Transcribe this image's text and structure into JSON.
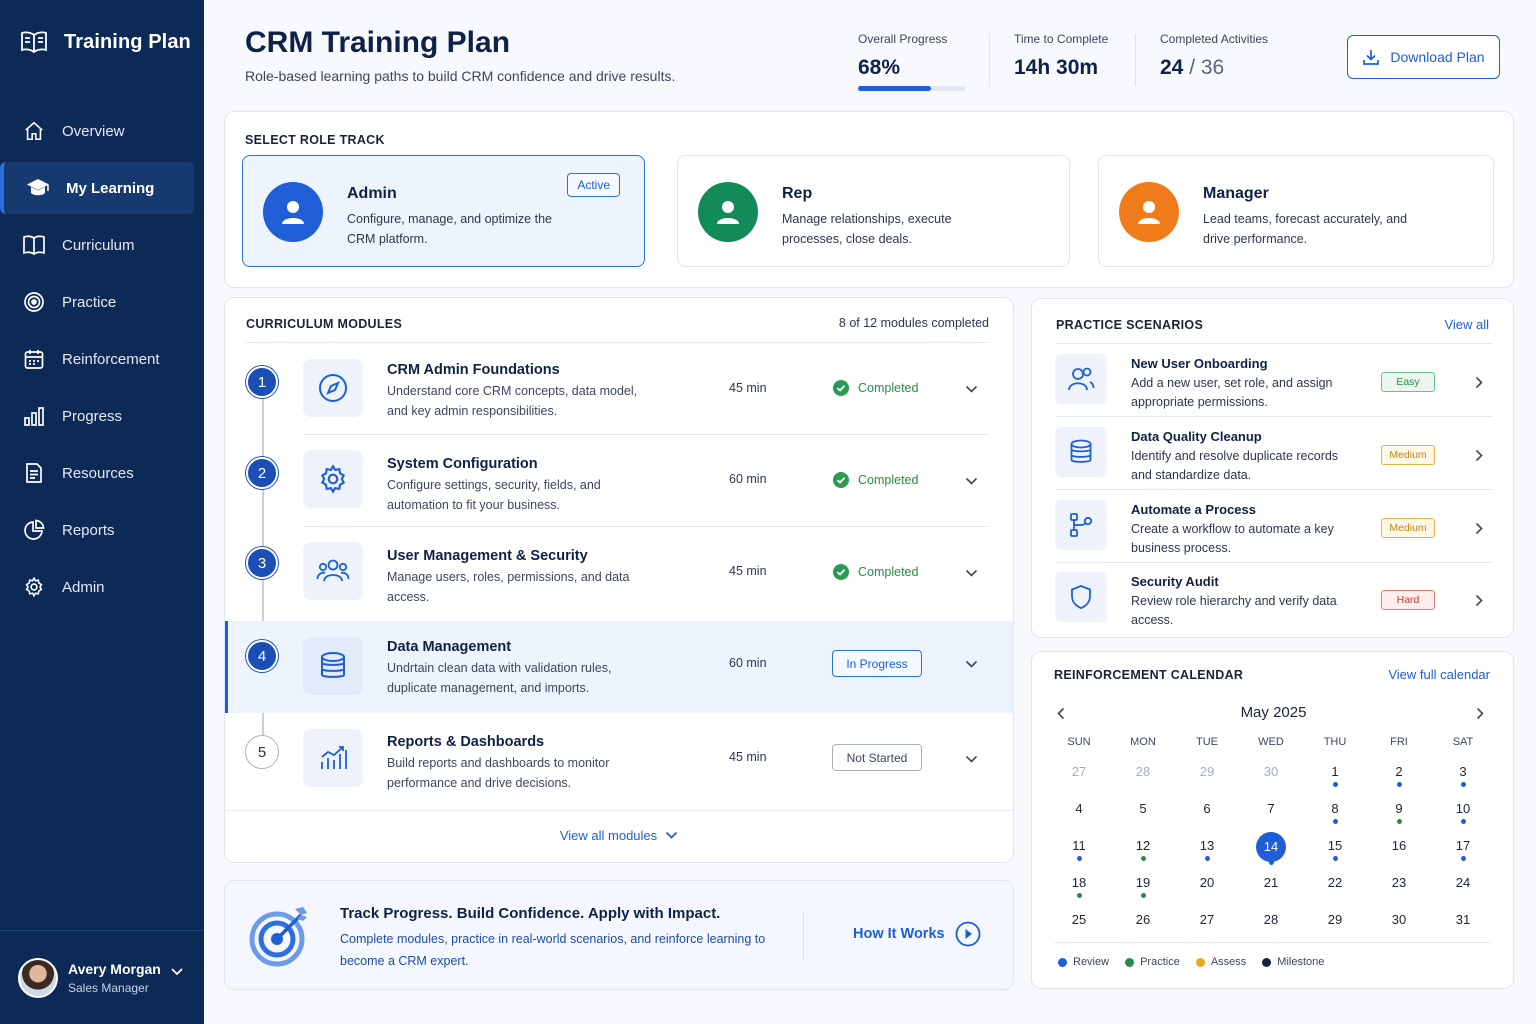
{
  "colors": {
    "sidebar": "#0d2a57",
    "primary": "#1f5ed6",
    "success": "#2b8a4a",
    "warning": "#e6b34a",
    "danger": "#c8372f",
    "admin": "#1f5ed6",
    "rep": "#138a5a",
    "manager": "#f07b1a"
  },
  "sidebar": {
    "brand": "Training Plan",
    "items": [
      {
        "label": "Overview",
        "icon": "home-icon"
      },
      {
        "label": "My Learning",
        "icon": "graduation-cap-icon",
        "active": true
      },
      {
        "label": "Curriculum",
        "icon": "book-icon"
      },
      {
        "label": "Practice",
        "icon": "target-icon"
      },
      {
        "label": "Reinforcement",
        "icon": "calendar-icon"
      },
      {
        "label": "Progress",
        "icon": "bar-chart-icon"
      },
      {
        "label": "Resources",
        "icon": "document-icon"
      },
      {
        "label": "Reports",
        "icon": "pie-chart-icon"
      },
      {
        "label": "Admin",
        "icon": "gear-icon"
      }
    ],
    "user": {
      "name": "Avery Morgan",
      "role": "Sales Manager"
    }
  },
  "header": {
    "title": "CRM Training Plan",
    "subtitle": "Role-based learning paths to build CRM confidence and drive results.",
    "stats": {
      "progress_label": "Overall Progress",
      "progress_value": "68%",
      "progress_fraction": 0.68,
      "time_label": "Time to Complete",
      "time_value": "14h 30m",
      "activities_label": "Completed Activities",
      "activities_done": "24",
      "activities_total": "/ 36"
    },
    "download_label": "Download Plan"
  },
  "roles": {
    "title": "SELECT ROLE TRACK",
    "active_badge": "Active",
    "items": [
      {
        "name": "Admin",
        "desc": "Configure, manage, and optimize the CRM platform."
      },
      {
        "name": "Rep",
        "desc": "Manage relationships, execute processes, close deals."
      },
      {
        "name": "Manager",
        "desc": "Lead teams, forecast accurately, and drive performance."
      }
    ]
  },
  "modules": {
    "title": "CURRICULUM MODULES",
    "count": "8 of 12 modules completed",
    "items": [
      {
        "num": "1",
        "icon": "compass-icon",
        "title": "CRM Admin Foundations",
        "desc": "Understand core CRM concepts, data model, and key admin responsibilities.",
        "time": "45 min",
        "status": "Completed"
      },
      {
        "num": "2",
        "icon": "gear-icon",
        "title": "System Configuration",
        "desc": "Configure settings, security, fields, and automation to fit your business.",
        "time": "60 min",
        "status": "Completed"
      },
      {
        "num": "3",
        "icon": "users-icon",
        "title": "User Management & Security",
        "desc": "Manage users, roles, permissions, and data access.",
        "time": "45 min",
        "status": "Completed"
      },
      {
        "num": "4",
        "icon": "database-icon",
        "title": "Data Management",
        "desc": "Undrtain clean data with validation rules, duplicate management, and imports.",
        "time": "60 min",
        "status": "In Progress"
      },
      {
        "num": "5",
        "icon": "analytics-icon",
        "title": "Reports & Dashboards",
        "desc": "Build reports and dashboards to monitor performance and drive decisions.",
        "time": "45 min",
        "status": "Not Started"
      }
    ],
    "view_all": "View all modules"
  },
  "track": {
    "title": "Track Progress. Build Confidence. Apply with Impact.",
    "desc": "Complete modules, practice in real-world scenarios, and reinforce learning to become a CRM expert.",
    "link": "How It Works"
  },
  "practice": {
    "title": "PRACTICE SCENARIOS",
    "view_all": "View all",
    "items": [
      {
        "icon": "users-icon",
        "title": "New User Onboarding",
        "desc": "Add a new user, set role, and assign appropriate permissions.",
        "difficulty": "Easy"
      },
      {
        "icon": "database-icon",
        "title": "Data Quality Cleanup",
        "desc": "Identify and resolve duplicate records and standardize data.",
        "difficulty": "Medium"
      },
      {
        "icon": "workflow-icon",
        "title": "Automate a Process",
        "desc": "Create a workflow to automate a key business process.",
        "difficulty": "Medium"
      },
      {
        "icon": "shield-icon",
        "title": "Security Audit",
        "desc": "Review role hierarchy and verify data access.",
        "difficulty": "Hard"
      }
    ]
  },
  "calendar": {
    "title": "REINFORCEMENT CALENDAR",
    "view_all": "View full calendar",
    "month": "May 2025",
    "weekdays": [
      "SUN",
      "MON",
      "TUE",
      "WED",
      "THU",
      "FRI",
      "SAT"
    ],
    "weeks": [
      [
        {
          "d": "27",
          "m": 1
        },
        {
          "d": "28",
          "m": 1
        },
        {
          "d": "29",
          "m": 1
        },
        {
          "d": "30",
          "m": 1
        },
        {
          "d": "1",
          "dot": "review"
        },
        {
          "d": "2",
          "dot": "review"
        },
        {
          "d": "3",
          "dot": "review"
        }
      ],
      [
        {
          "d": "4"
        },
        {
          "d": "5"
        },
        {
          "d": "6"
        },
        {
          "d": "7"
        },
        {
          "d": "8",
          "dot": "review"
        },
        {
          "d": "9",
          "dot": "practice"
        },
        {
          "d": "10",
          "dot": "review"
        }
      ],
      [
        {
          "d": "11",
          "dot": "review"
        },
        {
          "d": "12",
          "dot": "practice"
        },
        {
          "d": "13",
          "dot": "review"
        },
        {
          "d": "14",
          "today": 1,
          "dot": "review"
        },
        {
          "d": "15",
          "dot": "review"
        },
        {
          "d": "16"
        },
        {
          "d": "17",
          "dot": "review"
        }
      ],
      [
        {
          "d": "18",
          "dot": "practice"
        },
        {
          "d": "19",
          "dot": "practice"
        },
        {
          "d": "20"
        },
        {
          "d": "21"
        },
        {
          "d": "22"
        },
        {
          "d": "23"
        },
        {
          "d": "24"
        }
      ],
      [
        {
          "d": "25"
        },
        {
          "d": "26"
        },
        {
          "d": "27"
        },
        {
          "d": "28"
        },
        {
          "d": "29"
        },
        {
          "d": "30"
        },
        {
          "d": "31"
        }
      ]
    ],
    "legend": [
      {
        "label": "Review",
        "color": "#1f5ed6"
      },
      {
        "label": "Practice",
        "color": "#2b8a4a"
      },
      {
        "label": "Assess",
        "color": "#f0a51a"
      },
      {
        "label": "Milestone",
        "color": "#0f2146"
      }
    ]
  }
}
